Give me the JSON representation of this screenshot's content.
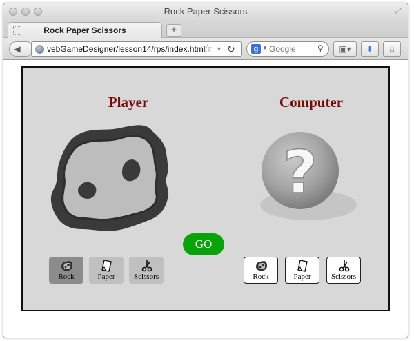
{
  "window": {
    "title": "Rock Paper Scissors"
  },
  "tab": {
    "label": "Rock Paper Scissors",
    "new_tab_label": "+"
  },
  "nav": {
    "url": "vebGameDesigner/lesson14/rps/index.html",
    "search_placeholder": "Google"
  },
  "game": {
    "player_title": "Player",
    "computer_title": "Computer",
    "go_label": "GO",
    "player_choices": [
      {
        "label": "Rock",
        "icon": "rock-icon",
        "selected": true
      },
      {
        "label": "Paper",
        "icon": "paper-icon",
        "selected": false
      },
      {
        "label": "Scissors",
        "icon": "scissors-icon",
        "selected": false
      }
    ],
    "computer_choices": [
      {
        "label": "Rock",
        "icon": "rock-icon"
      },
      {
        "label": "Paper",
        "icon": "paper-icon"
      },
      {
        "label": "Scissors",
        "icon": "scissors-icon"
      }
    ],
    "player_hand": "rock-image",
    "computer_hand": "question-mark-image",
    "colors": {
      "title": "#7a0b0b",
      "go_button": "#08a308",
      "board": "#d8d8d8",
      "selected_choice": "#8c8c8c",
      "choice": "#c0c0c0"
    }
  }
}
